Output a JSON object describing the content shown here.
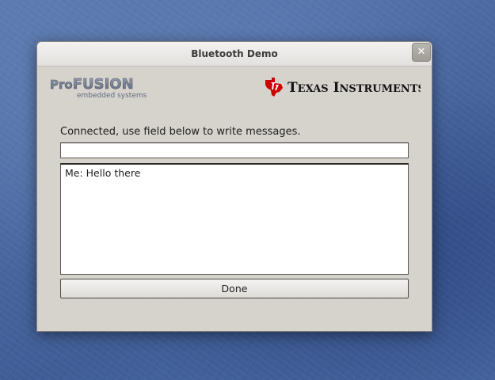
{
  "window": {
    "title": "Bluetooth Demo",
    "close_label": "✕"
  },
  "logos": {
    "left": {
      "name": "ProFUSION",
      "tagline": "embedded systems"
    },
    "right": {
      "name": "Texas Instruments",
      "colors": {
        "logo_mark": "#cc0000",
        "text": "#111111"
      }
    }
  },
  "main": {
    "status_text": "Connected, use field below to write messages.",
    "message_input": {
      "value": "",
      "placeholder": ""
    },
    "log_lines": [
      "Me: Hello there"
    ],
    "done_label": "Done"
  },
  "colors": {
    "window_bg": "#d6d2cc",
    "desktop_bg": "#4a68a0"
  }
}
